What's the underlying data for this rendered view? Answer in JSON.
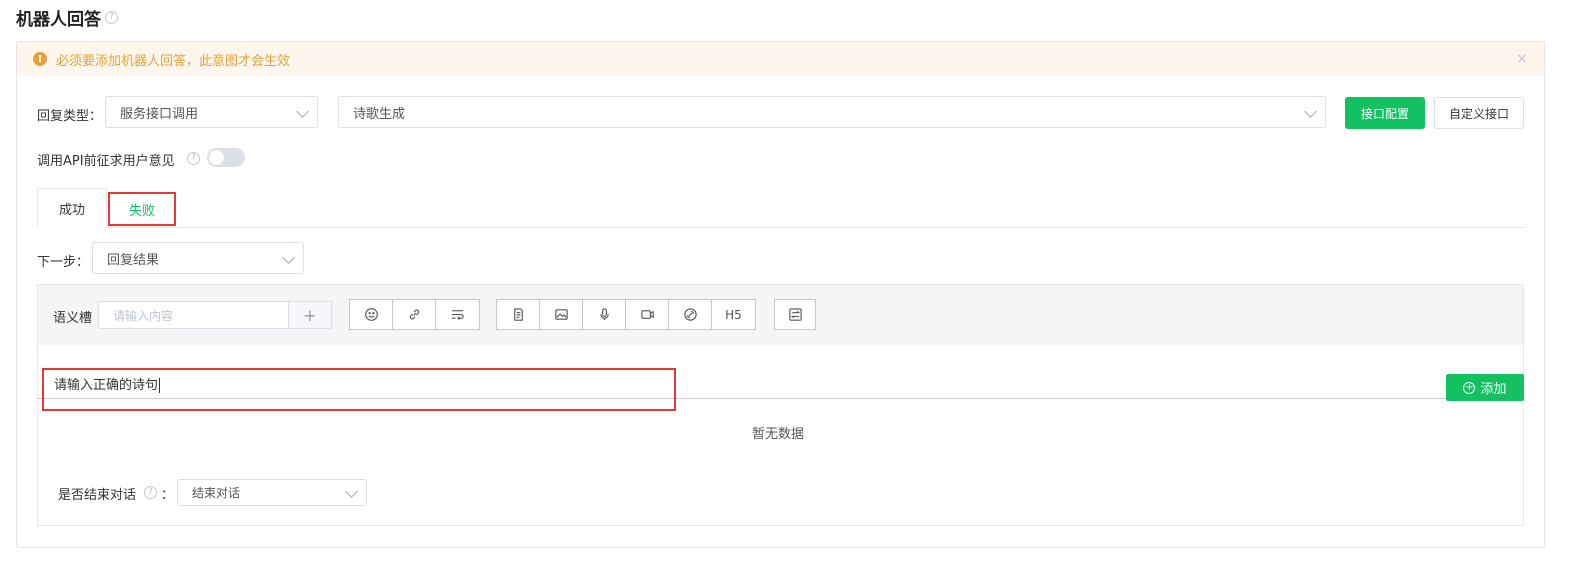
{
  "header": {
    "title": "机器人回答",
    "help_icon": "?"
  },
  "alert": {
    "message": "必须要添加机器人回答，此意图才会生效",
    "icon": "!",
    "close": "×",
    "color": "#e6a23c",
    "background": "#fdf6ec"
  },
  "reply_type": {
    "label": "回复类型：",
    "type_value": "服务接口调用",
    "service_value": "诗歌生成"
  },
  "buttons": {
    "api_config": "接口配置",
    "custom_api": "自定义接口"
  },
  "consent": {
    "label": "调用API前征求用户意见",
    "help_icon": "?",
    "enabled": false
  },
  "tabs": [
    {
      "label": "成功",
      "active": false
    },
    {
      "label": "失败",
      "active": true
    }
  ],
  "next_step": {
    "label": "下一步：",
    "value": "回复结果"
  },
  "slot": {
    "label": "语义槽",
    "placeholder": "请输入内容",
    "plus": "+"
  },
  "toolbar": {
    "h5_label": "H5"
  },
  "reply": {
    "text": "请输入正确的诗句",
    "add_label": "添加",
    "add_icon": "+"
  },
  "empty_text": "暂无数据",
  "end_dialog": {
    "label": "是否结束对话",
    "help_icon": "?",
    "colon": "：",
    "value": "结束对话"
  },
  "colors": {
    "primary": "#13c161",
    "highlight_box": "#e53935"
  }
}
